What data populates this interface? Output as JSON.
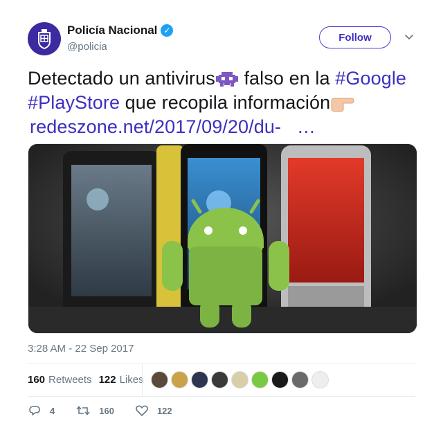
{
  "author": {
    "name": "Policía Nacional",
    "handle": "@policia",
    "verified": true
  },
  "follow_label": "Follow",
  "tweet": {
    "line1_plain": "Detectado un antivirus",
    "line1_plain2": " falso en la ",
    "hashtag_google": "#Google",
    "hashtag_playstore": "#PlayStore",
    "line2_plain": " que recopila información",
    "link": "redeszone.net/2017/09/20/du-",
    "ellipsis": "…"
  },
  "timestamp": "3:28 AM - 22 Sep 2017",
  "stats": {
    "retweets_count": "160",
    "retweets_label": "Retweets",
    "likes_count": "122",
    "likes_label": "Likes"
  },
  "actions": {
    "reply_count": "4",
    "retweet_count": "160",
    "like_count": "122"
  },
  "colors": {
    "accent": "#3c2fc0",
    "verified": "#1da1f2",
    "muted": "#657786"
  }
}
